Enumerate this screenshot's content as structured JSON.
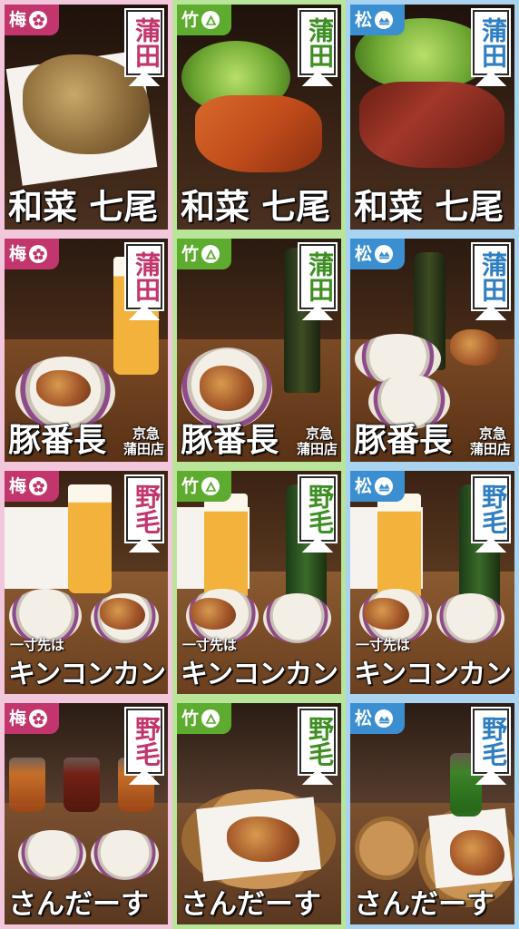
{
  "ranks": {
    "ume": "梅",
    "take": "竹",
    "matsu": "松"
  },
  "icons": {
    "ume": "plum-blossom-crest-icon",
    "take": "bamboo-crest-icon",
    "matsu": "pine-crest-icon"
  },
  "colors": {
    "ume": "#c2366d",
    "take": "#5dac2f",
    "matsu": "#3b8fd1"
  },
  "rows": [
    {
      "area": "蒲田",
      "name": "和菜 七尾",
      "sub_line1": "",
      "sub_line2": "",
      "prefix": ""
    },
    {
      "area": "蒲田",
      "name": "豚番長",
      "sub_line1": "京急",
      "sub_line2": "蒲田店",
      "prefix": ""
    },
    {
      "area": "野毛",
      "name": "キンコンカン",
      "sub_line1": "",
      "sub_line2": "",
      "prefix": "一寸先は"
    },
    {
      "area": "野毛",
      "name": "さんだーす",
      "sub_line1": "",
      "sub_line2": "",
      "prefix": ""
    }
  ]
}
